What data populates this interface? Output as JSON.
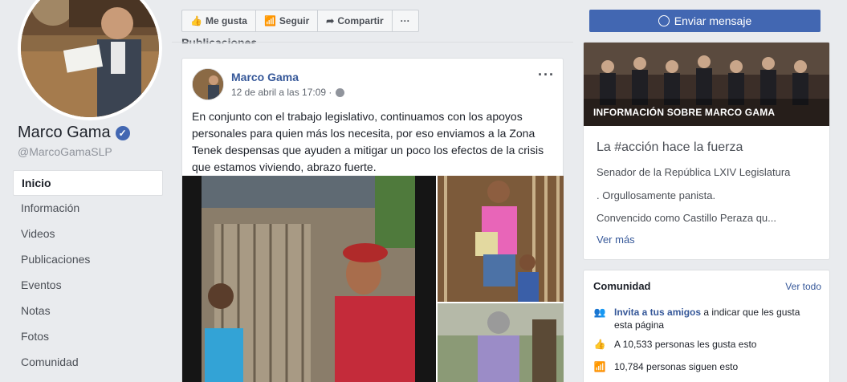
{
  "page": {
    "name": "Marco Gama",
    "handle": "@MarcoGamaSLP"
  },
  "nav": {
    "items": [
      {
        "label": "Inicio"
      },
      {
        "label": "Información"
      },
      {
        "label": "Videos"
      },
      {
        "label": "Publicaciones"
      },
      {
        "label": "Eventos"
      },
      {
        "label": "Notas"
      },
      {
        "label": "Fotos"
      },
      {
        "label": "Comunidad"
      }
    ]
  },
  "actions": {
    "like": "Me gusta",
    "follow": "Seguir",
    "share": "Compartir",
    "more": "···"
  },
  "section_title": "Publicaciones",
  "post": {
    "author": "Marco Gama",
    "time": "12 de abril a las 17:09 ·",
    "more": "···",
    "text": "En conjunto con el trabajo legislativo, continuamos con los apoyos personales para quien más los necesita, por eso enviamos a la Zona Tenek despensas que ayuden a mitigar un poco los efectos de la crisis que estamos viviendo, abrazo fuerte."
  },
  "sidebar": {
    "send_message": "Enviar mensaje",
    "info_banner": "INFORMACIÓN SOBRE MARCO GAMA",
    "info_headline": "La #acción hace la fuerza",
    "info_lines": [
      "Senador de la República LXIV Legislatura",
      ". Orgullosamente panista.",
      "Convencido como Castillo Peraza qu..."
    ],
    "info_more": "Ver más",
    "community_title": "Comunidad",
    "community_all": "Ver todo",
    "invite_link": "Invita a tus amigos",
    "invite_rest": " a indicar que les gusta esta página",
    "likes": "A 10,533 personas les gusta esto",
    "follows": "10,784 personas siguen esto"
  },
  "colors": {
    "brand": "#4267b2",
    "link": "#365899",
    "background": "#e9ebee"
  }
}
